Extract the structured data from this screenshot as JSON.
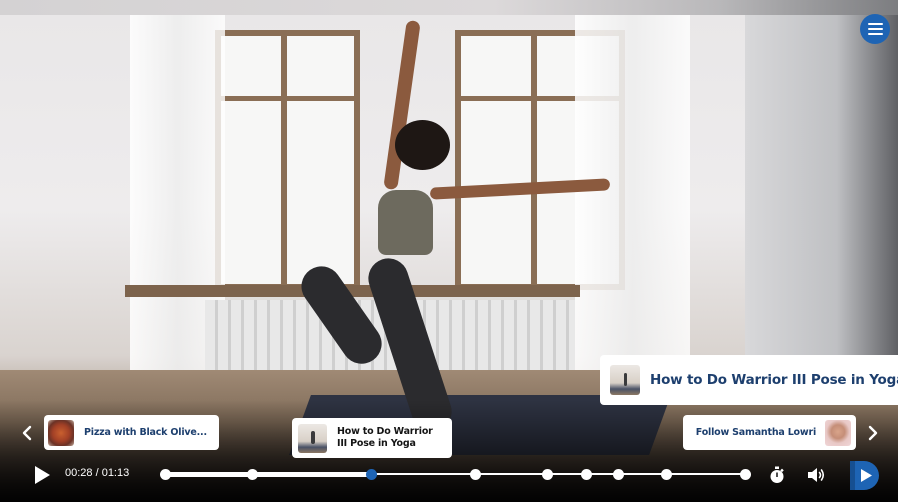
{
  "player": {
    "menu_icon": "hamburger-menu-icon",
    "accent_color": "#1e64b4",
    "title_color": "#1d3f6e"
  },
  "pinned_card": {
    "title": "How to Do Warrior III Pose in Yoga",
    "thumbnail": "yoga-pose-thumbnail"
  },
  "carousel": {
    "prev_icon": "chevron-left-icon",
    "next_icon": "chevron-right-icon",
    "items": [
      {
        "title": "Pizza with Black Olive...",
        "thumbnail": "pizza-thumbnail"
      },
      {
        "title": "How to Do Warrior III Pose in Yoga",
        "thumbnail": "yoga-pose-thumbnail"
      },
      {
        "title": "Follow Samantha Lowri",
        "thumbnail": "samantha-lowri-avatar"
      }
    ]
  },
  "controls": {
    "play_icon": "play-icon",
    "current_time": "00:28",
    "duration": "01:13",
    "time_display": "00:28 / 01:13",
    "progress_fraction": 0.356,
    "chapter_markers": [
      0,
      0.15,
      0.356,
      0.534,
      0.659,
      0.726,
      0.781,
      0.864,
      1.0
    ],
    "current_marker_index": 2,
    "timer_icon": "stopwatch-icon",
    "volume_icon": "volume-icon",
    "logo_icon": "player-logo-icon"
  }
}
